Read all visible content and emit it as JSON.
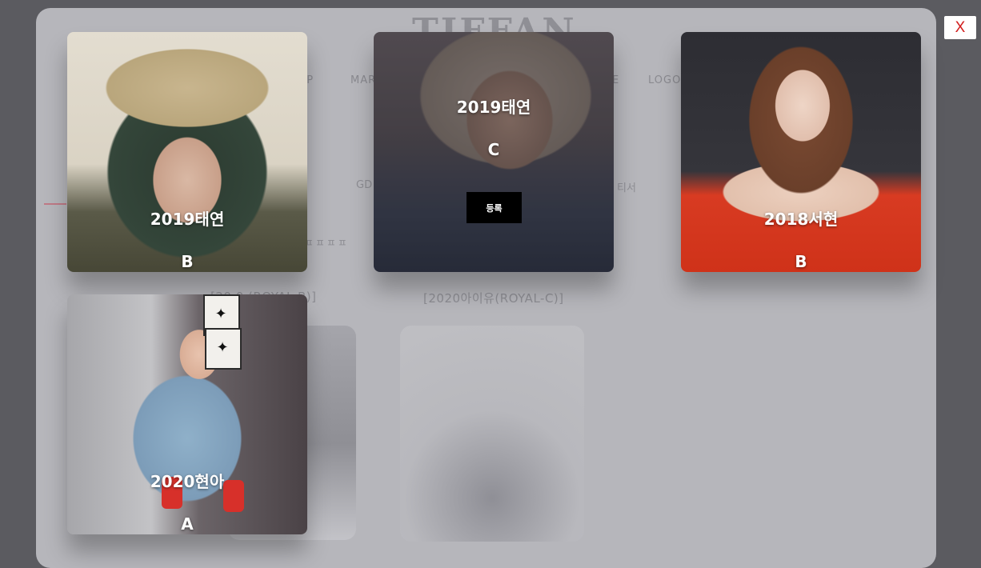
{
  "background": {
    "logo": "TIFFAN",
    "nav": [
      "OP",
      "MAR",
      "E",
      "LOGO"
    ],
    "labels": [
      "GD",
      "티서",
      "ㅍㅍㅍㅍ"
    ],
    "products": [
      "[20 0 (ROYAL-B)]",
      "[2020아이유(ROYAL-C)]"
    ]
  },
  "modal": {
    "close_label": "X",
    "cards": [
      {
        "name": "2019태연",
        "grade": "B"
      },
      {
        "name": "2019태연",
        "grade": "C",
        "action_label": "등록"
      },
      {
        "name": "2018서현",
        "grade": "B"
      },
      {
        "name": "2020현아",
        "grade": "A"
      }
    ]
  },
  "colors": {
    "overlay": "#5b5b60",
    "close_text": "#d21c1c",
    "register_bg": "#000000"
  }
}
